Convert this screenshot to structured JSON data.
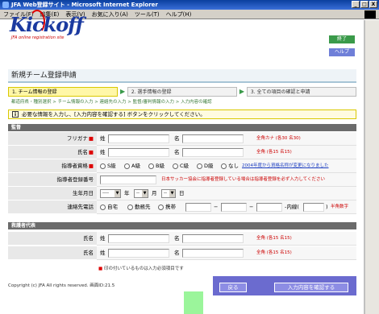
{
  "window": {
    "title": "JFA Web登録サイト - Microsoft Internet Explorer",
    "btn_min": "_",
    "btn_max": "□",
    "btn_close": "X"
  },
  "menu": [
    "ファイル(F)",
    "編集(E)",
    "表示(V)",
    "お気に入り(A)",
    "ツール(T)",
    "ヘルプ(H)"
  ],
  "brand": {
    "logo": "Kickoff",
    "sub": "JFA online registration site"
  },
  "header": {
    "logout": "終了",
    "help": "ヘルプ"
  },
  "page": {
    "title": "新規チーム登録申請"
  },
  "steps": [
    "1. チーム情報の登録",
    "2. 選手情報の登録",
    "3. 全ての項目の確認と申請"
  ],
  "crumb": "都道府県・種別選択 > チーム情報の入力 > 連絡先の入力 > 監督/審判情報の入力 > 入力内容の確認",
  "notice": "必要な情報を入力し、[入力内容を確認する] ボタンをクリックしてください。",
  "section1": {
    "title": "監督",
    "furigana": {
      "label": "フリガナ",
      "sei": "姓",
      "mei": "名",
      "note": "全角カナ (各30 名30)"
    },
    "name": {
      "label": "氏名",
      "sei": "姓",
      "mei": "名",
      "note": "全角 (各15 名15)"
    },
    "qualification": {
      "label": "指導者資格",
      "options": [
        "S級",
        "A級",
        "B級",
        "C級",
        "D級",
        "なし"
      ],
      "link": "2004年度から資格名称が変更になりました"
    },
    "license_no": {
      "label": "指導者登録番号",
      "note": "日本サッカー協会に指導者登録している場合は指導者登録を必ず入力してください"
    },
    "birthdate": {
      "label": "生年月日",
      "year_val": "----",
      "month_val": "--",
      "day_val": "--",
      "year": "年",
      "month": "月",
      "day": "日"
    },
    "phone": {
      "label": "連絡先電話",
      "options": [
        "自宅",
        "勤務先",
        "携帯"
      ],
      "dash": "−",
      "ext": "-内線(",
      "close": ")",
      "note": "半角数字"
    }
  },
  "section2": {
    "title": "救護者代表",
    "name1": {
      "label": "氏名",
      "sei": "姓",
      "mei": "名",
      "note": "全角 (各15 名15)"
    },
    "name2": {
      "label": "氏名",
      "sei": "姓",
      "mei": "名",
      "note": "全角 (各15 名15)"
    }
  },
  "footnote": {
    "mark": "■",
    "text": "印の付いているものは入力必須項目です"
  },
  "footer": {
    "copyright": "Copyright (c) JFA All rights reserved. 画面ID:21.5"
  },
  "actions": {
    "back": "戻る",
    "confirm": "入力内容を確認する"
  }
}
